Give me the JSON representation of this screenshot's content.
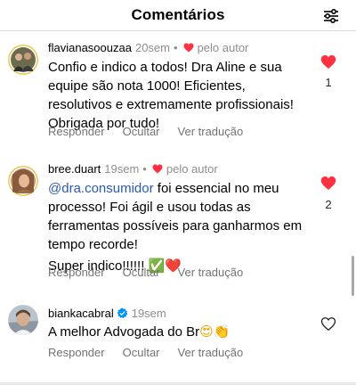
{
  "header": {
    "title": "Comentários",
    "filter_icon": "sliders-icon"
  },
  "comments": [
    {
      "username": "flavianasoouzaa",
      "time": "20sem",
      "separator": "•",
      "author_label": "pelo autor",
      "lines": [
        "Confio e indico a todos! Dra Aline e sua",
        "equipe são nota 1000! Eficientes,",
        "resolutivos e extremamente profissionais!",
        "Obrigada por tudo!"
      ],
      "actions": {
        "reply": "Responder",
        "hide": "Ocultar",
        "translate": "Ver tradução"
      },
      "likes": "1",
      "liked": true
    },
    {
      "username": "bree.duart",
      "time": "19sem",
      "separator": "•",
      "author_label": "pelo autor",
      "mention": "@dra.consumidor",
      "line1_rest": " foi essencial no meu",
      "lines": [
        "processo! Foi ágil e usou todas as",
        "ferramentas possíveis para ganharmos em",
        "tempo recorde!"
      ],
      "line_last": "Super indico!!!!!! ",
      "emojis_last": [
        "✅",
        "❤️"
      ],
      "actions": {
        "reply": "Responder",
        "hide": "Ocultar",
        "translate": "Ver tradução"
      },
      "likes": "2",
      "liked": true
    },
    {
      "username": "biankacabral",
      "verified": true,
      "time": "19sem",
      "text": "A melhor Advogada do Br",
      "emojis": [
        "😍",
        "👏"
      ],
      "actions": {
        "reply": "Responder",
        "hide": "Ocultar",
        "translate": "Ver tradução"
      },
      "liked": false
    }
  ],
  "colors": {
    "heart": "#ff3040",
    "muted": "#8e8e8e",
    "mention": "#2a5ca8",
    "verified": "#0095f6"
  }
}
